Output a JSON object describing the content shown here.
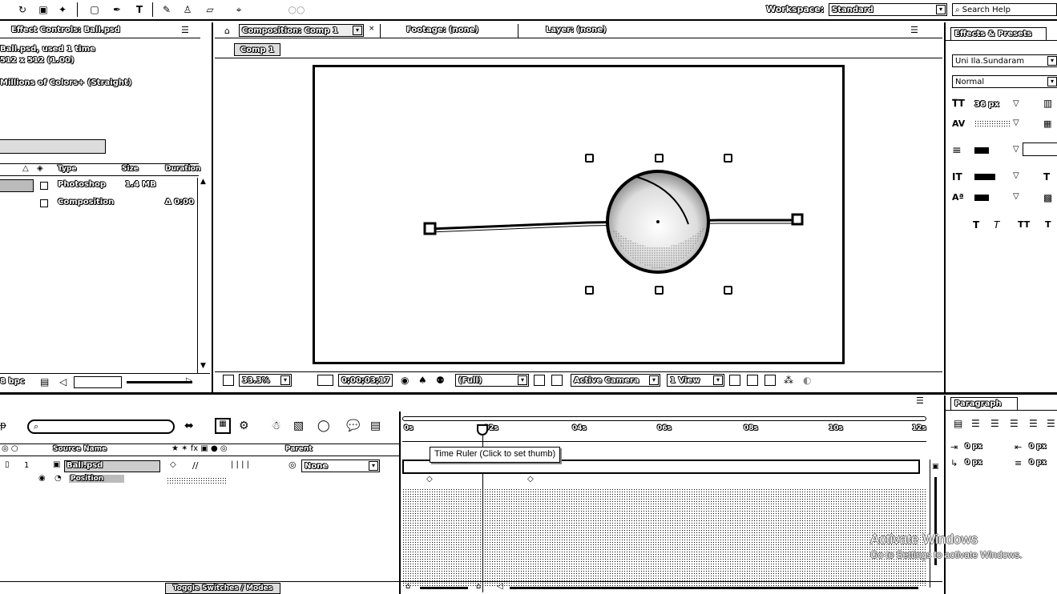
{
  "toolbar": {
    "icons": [
      "rotate-icon",
      "camera-icon",
      "pan-behind-icon",
      "rectangle-mask-icon",
      "pen-icon",
      "text-icon",
      "brush-icon",
      "clone-stamp-icon",
      "eraser-icon",
      "puppet-pin-icon",
      "axis-icon"
    ],
    "workspace_label": "Workspace:",
    "workspace_value": "Standard",
    "search_help_placeholder": "Search Help"
  },
  "project_panel": {
    "tab_title": "Effect Controls: Ball.psd",
    "selected_name": "Ball.psd",
    "selected_used": ", used 1 time",
    "dimensions": "512 x 512 (1.00)",
    "color_depth": "Millions of Colors+ (Straight)",
    "columns": {
      "type": "Type",
      "size": "Size",
      "duration": "Duration"
    },
    "items": [
      {
        "type": "Photoshop",
        "size": "1.4 MB",
        "duration": ""
      },
      {
        "type": "Composition",
        "size": "",
        "duration": "Δ 0:00"
      }
    ],
    "bpc_label": "8 bpc"
  },
  "viewer": {
    "tabs": [
      {
        "label": "Composition: Comp 1"
      },
      {
        "label": "Footage: (none)"
      },
      {
        "label": "Layer: (none)"
      }
    ],
    "comp_button": "Comp 1",
    "zoom": "33.3%",
    "timecode": "0;00;03;17",
    "resolution": "(Full)",
    "camera": "Active Camera",
    "view_layout": "1 View"
  },
  "effects_panel": {
    "tab_title": "Effects & Presets",
    "font_name": "Uni Ila.Sundaram",
    "font_style": "Normal",
    "size_value": "36 px"
  },
  "paragraph_panel": {
    "tab_title": "Paragraph",
    "values": [
      "0 px",
      "0 px",
      "0 px",
      "0 px"
    ]
  },
  "timeline": {
    "columns": {
      "source_name": "Source Name",
      "parent": "Parent"
    },
    "layer": {
      "number": "1",
      "name": "Ball.psd",
      "parent": "None"
    },
    "property": {
      "name": "Position"
    },
    "ruler_ticks": [
      "0s",
      "02s",
      "04s",
      "06s",
      "08s",
      "10s",
      "12s"
    ],
    "tooltip": "Time Ruler (Click to set thumb)",
    "toggle_label": "Toggle Switches / Modes",
    "current_time_fraction": 0.155
  },
  "watermark": {
    "line1": "Activate Windows",
    "line2": "Go to Settings to activate Windows."
  }
}
